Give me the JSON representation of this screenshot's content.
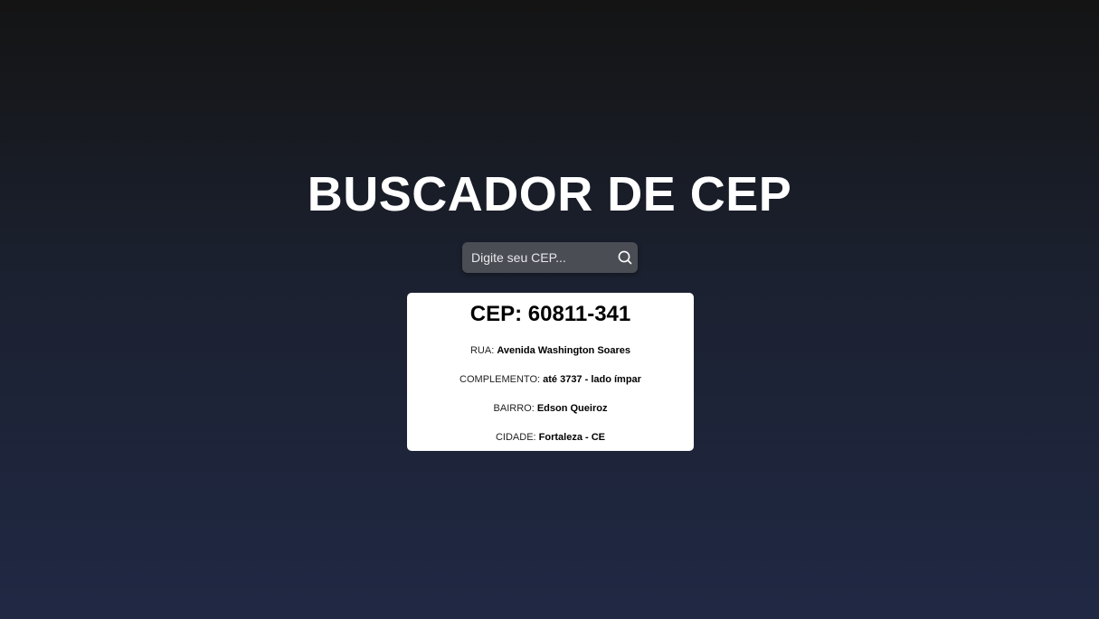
{
  "header": {
    "title": "BUSCADOR DE CEP"
  },
  "search": {
    "placeholder": "Digite seu CEP...",
    "value": "",
    "button_icon": "search-icon"
  },
  "result": {
    "cep_label": "CEP:",
    "cep_value": "60811-341",
    "fields": {
      "rua": {
        "label": "RUA:",
        "value": "Avenida Washington Soares"
      },
      "complemento": {
        "label": "COMPLEMENTO:",
        "value": "até 3737 - lado ímpar"
      },
      "bairro": {
        "label": "BAIRRO:",
        "value": "Edson Queiroz"
      },
      "cidade": {
        "label": "CIDADE:",
        "value": "Fortaleza - CE"
      }
    }
  },
  "colors": {
    "background_top": "#141414",
    "background_bottom": "#202844",
    "search_box": "#4b4d55",
    "card": "#ffffff",
    "title": "#ffffff"
  }
}
